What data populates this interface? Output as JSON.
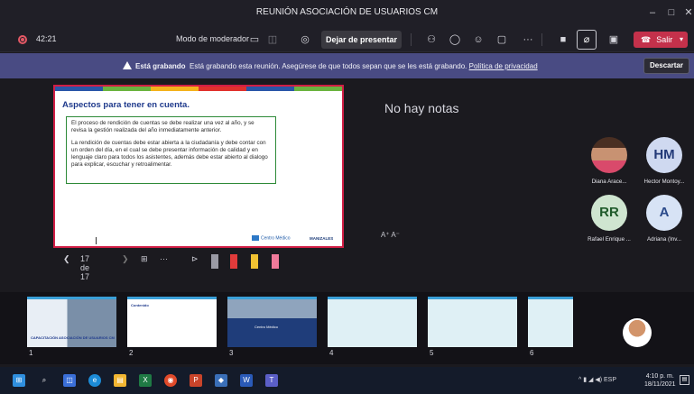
{
  "window": {
    "title": "REUNIÓN ASOCIACIÓN DE USUARIOS CM"
  },
  "controls": {
    "timer": "42:21",
    "moderator_label": "Modo de moderador",
    "stop_presenting": "Dejar de presentar",
    "leave": "Salir"
  },
  "banner": {
    "bold": "Está grabando",
    "message": "Está grabando esta reunión. Asegúrese de que todos sepan que se les está grabando.",
    "link": "Política de privacidad",
    "dismiss": "Descartar"
  },
  "slide": {
    "title": "Aspectos para tener en cuenta.",
    "paragraph1": "El proceso de rendición de cuentas se debe realizar una vez al año, y se revisa la gestión realizada del año inmediatamente anterior.",
    "paragraph2": "La rendición de cuentas debe estar abierta a la ciudadanía y debe contar con un orden del día, en el cual se debe presentar información de calidad y en lenguaje claro para todos los asistentes, además debe estar abierto al dialogo para explicar, escuchar y retroalimentar.",
    "logo": "Centro Médico",
    "logo2": "MANIZALES"
  },
  "notes": {
    "empty": "No hay notas",
    "font_controls": "A⁺  A⁻"
  },
  "slide_nav": {
    "counter": "17 de 17"
  },
  "participants": [
    {
      "initials": "",
      "name": "Diana Arace...",
      "bg": "#f2f2f5",
      "photo": true
    },
    {
      "initials": "HM",
      "name": "Hector Montoy...",
      "bg": "#cfd9f0",
      "color": "#233a78"
    },
    {
      "initials": "RR",
      "name": "Rafael Enrique ...",
      "bg": "#cfe5d0",
      "color": "#1f5a2a"
    },
    {
      "initials": "A",
      "name": "Adriana (Inv...",
      "bg": "#d7e3f5",
      "color": "#2a4a8a"
    }
  ],
  "thumbnails": [
    {
      "num": "1",
      "caption": "CAPACITACIÓN ASOCIACIÓN DE USUARIOS CM"
    },
    {
      "num": "2",
      "caption": "Contenido"
    },
    {
      "num": "3",
      "caption": "Centro Médico"
    },
    {
      "num": "4",
      "caption": ""
    },
    {
      "num": "5",
      "caption": ""
    },
    {
      "num": "6",
      "caption": ""
    }
  ],
  "taskbar": {
    "tray": "ESP",
    "time": "4:10 p. m.",
    "date": "18/11/2021"
  }
}
